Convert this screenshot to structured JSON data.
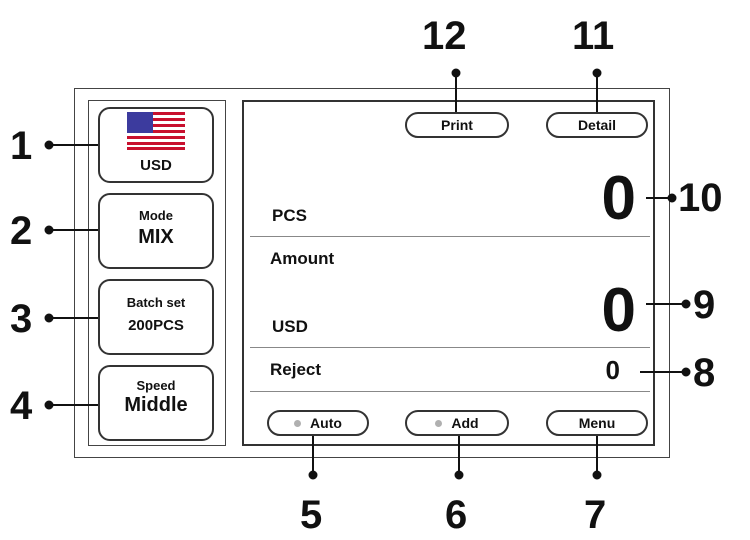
{
  "left_buttons": {
    "currency": {
      "label": "USD",
      "icon": "us-flag-icon"
    },
    "mode": {
      "title": "Mode",
      "value": "MIX"
    },
    "batch": {
      "title": "Batch set",
      "value": "200PCS"
    },
    "speed": {
      "title": "Speed",
      "value": "Middle"
    }
  },
  "screen": {
    "print_label": "Print",
    "detail_label": "Detail",
    "pcs_label": "PCS",
    "pcs_value": "0",
    "amount_label": "Amount",
    "amount_currency": "USD",
    "amount_value": "0",
    "reject_label": "Reject",
    "reject_value": "0",
    "auto_label": "Auto",
    "add_label": "Add",
    "menu_label": "Menu"
  },
  "callouts": [
    "1",
    "2",
    "3",
    "4",
    "5",
    "6",
    "7",
    "8",
    "9",
    "10",
    "11",
    "12"
  ],
  "colors": {
    "flag_red": "#c8102e",
    "flag_blue": "#3c3b9e",
    "indicator_dot": "#b0b0b0"
  }
}
